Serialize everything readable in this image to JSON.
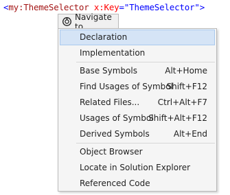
{
  "code_line": {
    "open_bracket": "<",
    "tag": "my:ThemeSelector",
    "attr": "x:Key",
    "equals": "=",
    "value": "\"ThemeSelector\"",
    "close_bracket": ">"
  },
  "popup": {
    "title": "Navigate to",
    "groups": [
      [
        {
          "label": "Declaration",
          "shortcut": "",
          "selected": true
        },
        {
          "label": "Implementation",
          "shortcut": ""
        }
      ],
      [
        {
          "label": "Base Symbols",
          "shortcut": "Alt+Home"
        },
        {
          "label": "Find Usages of Symbol",
          "shortcut": "Shift+F12"
        },
        {
          "label": "Related Files...",
          "shortcut": "Ctrl+Alt+F7"
        },
        {
          "label": "Usages of Symbol",
          "shortcut": "Shift+Alt+F12"
        },
        {
          "label": "Derived Symbols",
          "shortcut": "Alt+End"
        }
      ],
      [
        {
          "label": "Object Browser",
          "shortcut": ""
        },
        {
          "label": "Locate in Solution Explorer",
          "shortcut": ""
        },
        {
          "label": "Referenced Code",
          "shortcut": ""
        }
      ]
    ]
  },
  "colors": {
    "selection_bg": "#d5e4f6",
    "selection_border": "#a8c8ee",
    "menu_bg": "#f5f5f5",
    "xml_tag": "#a31515",
    "xml_attr": "#ff0000",
    "xml_value": "#0000ff"
  },
  "icons": {
    "navigate": "resharper-navigate-icon"
  }
}
